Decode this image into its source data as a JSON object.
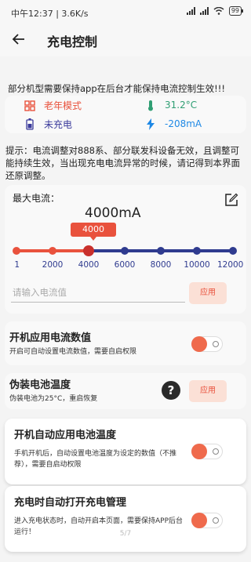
{
  "status_bar": {
    "time_speed": "中午12:37 | 3.6K/s",
    "battery": "99"
  },
  "header": {
    "title": "充电控制",
    "back_icon": "arrow-left-icon"
  },
  "warning": "部分机型需要保持app在后台才能保持电流控制生效!!!",
  "info": {
    "mode": {
      "icon": "grid-icon",
      "label": "老年模式",
      "color": "#e9523d"
    },
    "temperature": {
      "icon": "thermometer-icon",
      "label": "31.2°C",
      "color": "#2f9e73"
    },
    "charge_state": {
      "icon": "battery-icon",
      "label": "未充电",
      "color": "#3b3b9c"
    },
    "current": {
      "icon": "bolt-icon",
      "label": "-208mA",
      "color": "#1e88e5"
    }
  },
  "tip": "提示：电流调整对888系、部分联发科设备无效，且调整可能持续生效，当出现充电电流异常的时候，请记得到本界面还原调整。",
  "max_current": {
    "label": "最大电流：",
    "value_display": "4000mA",
    "bubble": "4000",
    "ticks": [
      "1",
      "2000",
      "4000",
      "6000",
      "8000",
      "10000",
      "12000"
    ],
    "selected_index": 2,
    "input_placeholder": "请输入电流值",
    "apply_label": "应用"
  },
  "boot_current": {
    "title": "开机应用电流数值",
    "desc": "开启可自动设置电流数值，需要自启权限",
    "enabled": true
  },
  "fake_temp": {
    "title": "伪装电池温度",
    "desc": "伪装电池为25°C，重启恢复",
    "help": "?",
    "apply_label": "应用"
  },
  "boot_temp": {
    "title": "开机自动应用电池温度",
    "desc": "手机开机后，自动设置电池温度为设定的数值（不推荐），需要自启动权限",
    "enabled": true
  },
  "charge_manage": {
    "title": "充电时自动打开充电管理",
    "desc": "进入充电状态时，自动开启本页面，需要保持APP后台运行！",
    "enabled": true
  },
  "page_indicator": "5/7",
  "colors": {
    "accent": "#e9523d",
    "slider_blue": "#2f3b8f"
  }
}
